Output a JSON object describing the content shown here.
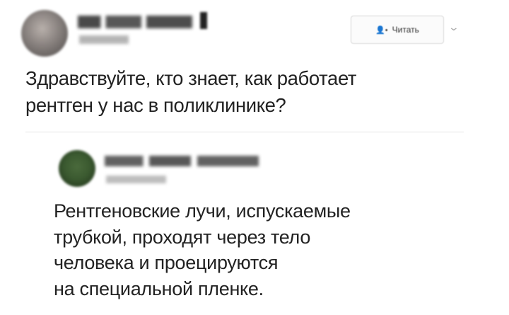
{
  "tweet": {
    "follow_label": "Читать",
    "chevron": "⌄",
    "text_lines": [
      "Здравствуйте, кто знает, как работает",
      "рентген у нас в поликлинике?"
    ]
  },
  "reply": {
    "text_lines": [
      "Рентгеновские лучи, испускаемые",
      "трубкой, проходят через тело",
      "человека и проецируются",
      "на специальной пленке."
    ]
  },
  "icons": {
    "follow": "add-person-icon",
    "more": "chevron-down-icon"
  }
}
